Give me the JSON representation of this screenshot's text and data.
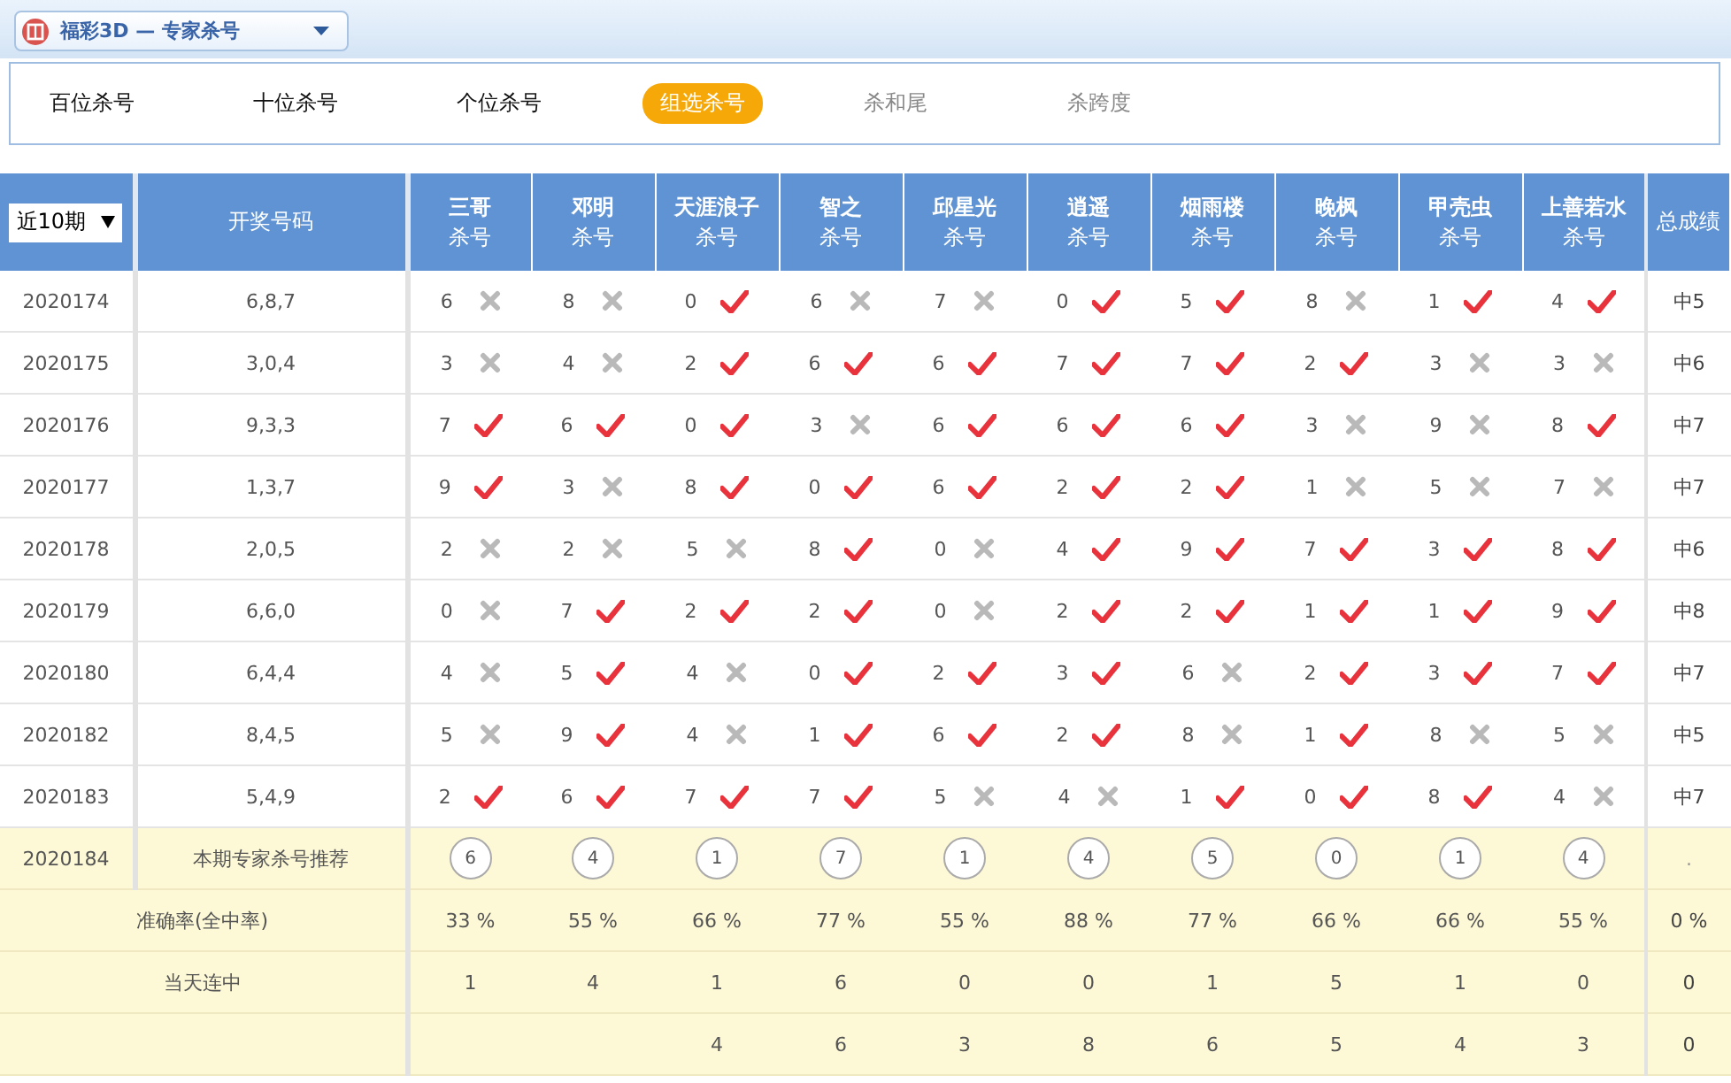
{
  "header": {
    "title": "福彩3D — 专家杀号"
  },
  "tabs": [
    {
      "label": "百位杀号",
      "selected": false,
      "disabled": false
    },
    {
      "label": "十位杀号",
      "selected": false,
      "disabled": false
    },
    {
      "label": "个位杀号",
      "selected": false,
      "disabled": false
    },
    {
      "label": "组选杀号",
      "selected": true,
      "disabled": false
    },
    {
      "label": "杀和尾",
      "selected": false,
      "disabled": true
    },
    {
      "label": "杀跨度",
      "selected": false,
      "disabled": true
    }
  ],
  "period_select": {
    "value": "近10期"
  },
  "columns": {
    "draw": "开奖号码",
    "total": "总成绩",
    "experts": [
      {
        "name": "三哥",
        "sub": "杀号"
      },
      {
        "name": "邓明",
        "sub": "杀号"
      },
      {
        "name": "天涯浪子",
        "sub": "杀号"
      },
      {
        "name": "智之",
        "sub": "杀号"
      },
      {
        "name": "邱星光",
        "sub": "杀号"
      },
      {
        "name": "逍遥",
        "sub": "杀号"
      },
      {
        "name": "烟雨楼",
        "sub": "杀号"
      },
      {
        "name": "晚枫",
        "sub": "杀号"
      },
      {
        "name": "甲壳虫",
        "sub": "杀号"
      },
      {
        "name": "上善若水",
        "sub": "杀号"
      }
    ]
  },
  "rows": [
    {
      "period": "2020174",
      "draw": "6,8,7",
      "total": "中5",
      "cells": [
        {
          "n": "6",
          "hit": false
        },
        {
          "n": "8",
          "hit": false
        },
        {
          "n": "0",
          "hit": true
        },
        {
          "n": "6",
          "hit": false
        },
        {
          "n": "7",
          "hit": false
        },
        {
          "n": "0",
          "hit": true
        },
        {
          "n": "5",
          "hit": true
        },
        {
          "n": "8",
          "hit": false
        },
        {
          "n": "1",
          "hit": true
        },
        {
          "n": "4",
          "hit": true
        }
      ]
    },
    {
      "period": "2020175",
      "draw": "3,0,4",
      "total": "中6",
      "cells": [
        {
          "n": "3",
          "hit": false
        },
        {
          "n": "4",
          "hit": false
        },
        {
          "n": "2",
          "hit": true
        },
        {
          "n": "6",
          "hit": true
        },
        {
          "n": "6",
          "hit": true
        },
        {
          "n": "7",
          "hit": true
        },
        {
          "n": "7",
          "hit": true
        },
        {
          "n": "2",
          "hit": true
        },
        {
          "n": "3",
          "hit": false
        },
        {
          "n": "3",
          "hit": false
        }
      ]
    },
    {
      "period": "2020176",
      "draw": "9,3,3",
      "total": "中7",
      "cells": [
        {
          "n": "7",
          "hit": true
        },
        {
          "n": "6",
          "hit": true
        },
        {
          "n": "0",
          "hit": true
        },
        {
          "n": "3",
          "hit": false
        },
        {
          "n": "6",
          "hit": true
        },
        {
          "n": "6",
          "hit": true
        },
        {
          "n": "6",
          "hit": true
        },
        {
          "n": "3",
          "hit": false
        },
        {
          "n": "9",
          "hit": false
        },
        {
          "n": "8",
          "hit": true
        }
      ]
    },
    {
      "period": "2020177",
      "draw": "1,3,7",
      "total": "中7",
      "cells": [
        {
          "n": "9",
          "hit": true
        },
        {
          "n": "3",
          "hit": false
        },
        {
          "n": "8",
          "hit": true
        },
        {
          "n": "0",
          "hit": true
        },
        {
          "n": "6",
          "hit": true
        },
        {
          "n": "2",
          "hit": true
        },
        {
          "n": "2",
          "hit": true
        },
        {
          "n": "1",
          "hit": false
        },
        {
          "n": "5",
          "hit": false
        },
        {
          "n": "7",
          "hit": false
        }
      ]
    },
    {
      "period": "2020178",
      "draw": "2,0,5",
      "total": "中6",
      "cells": [
        {
          "n": "2",
          "hit": false
        },
        {
          "n": "2",
          "hit": false
        },
        {
          "n": "5",
          "hit": false
        },
        {
          "n": "8",
          "hit": true
        },
        {
          "n": "0",
          "hit": false
        },
        {
          "n": "4",
          "hit": true
        },
        {
          "n": "9",
          "hit": true
        },
        {
          "n": "7",
          "hit": true
        },
        {
          "n": "3",
          "hit": true
        },
        {
          "n": "8",
          "hit": true
        }
      ]
    },
    {
      "period": "2020179",
      "draw": "6,6,0",
      "total": "中8",
      "cells": [
        {
          "n": "0",
          "hit": false
        },
        {
          "n": "7",
          "hit": true
        },
        {
          "n": "2",
          "hit": true
        },
        {
          "n": "2",
          "hit": true
        },
        {
          "n": "0",
          "hit": false
        },
        {
          "n": "2",
          "hit": true
        },
        {
          "n": "2",
          "hit": true
        },
        {
          "n": "1",
          "hit": true
        },
        {
          "n": "1",
          "hit": true
        },
        {
          "n": "9",
          "hit": true
        }
      ]
    },
    {
      "period": "2020180",
      "draw": "6,4,4",
      "total": "中7",
      "cells": [
        {
          "n": "4",
          "hit": false
        },
        {
          "n": "5",
          "hit": true
        },
        {
          "n": "4",
          "hit": false
        },
        {
          "n": "0",
          "hit": true
        },
        {
          "n": "2",
          "hit": true
        },
        {
          "n": "3",
          "hit": true
        },
        {
          "n": "6",
          "hit": false
        },
        {
          "n": "2",
          "hit": true
        },
        {
          "n": "3",
          "hit": true
        },
        {
          "n": "7",
          "hit": true
        }
      ]
    },
    {
      "period": "2020182",
      "draw": "8,4,5",
      "total": "中5",
      "cells": [
        {
          "n": "5",
          "hit": false
        },
        {
          "n": "9",
          "hit": true
        },
        {
          "n": "4",
          "hit": false
        },
        {
          "n": "1",
          "hit": true
        },
        {
          "n": "6",
          "hit": true
        },
        {
          "n": "2",
          "hit": true
        },
        {
          "n": "8",
          "hit": false
        },
        {
          "n": "1",
          "hit": true
        },
        {
          "n": "8",
          "hit": false
        },
        {
          "n": "5",
          "hit": false
        }
      ]
    },
    {
      "period": "2020183",
      "draw": "5,4,9",
      "total": "中7",
      "cells": [
        {
          "n": "2",
          "hit": true
        },
        {
          "n": "6",
          "hit": true
        },
        {
          "n": "7",
          "hit": true
        },
        {
          "n": "7",
          "hit": true
        },
        {
          "n": "5",
          "hit": false
        },
        {
          "n": "4",
          "hit": false
        },
        {
          "n": "1",
          "hit": true
        },
        {
          "n": "0",
          "hit": true
        },
        {
          "n": "8",
          "hit": true
        },
        {
          "n": "4",
          "hit": false
        }
      ]
    }
  ],
  "recommend": {
    "period": "2020184",
    "label": "本期专家杀号推荐",
    "picks": [
      "6",
      "4",
      "1",
      "7",
      "1",
      "4",
      "5",
      "0",
      "1",
      "4"
    ],
    "total": "."
  },
  "accuracy": {
    "label": "准确率(全中率)",
    "values": [
      "33 %",
      "55 %",
      "66 %",
      "77 %",
      "55 %",
      "88 %",
      "77 %",
      "66 %",
      "66 %",
      "55 %"
    ],
    "total": "0 %"
  },
  "streak": {
    "label": "当天连中",
    "values": [
      "1",
      "4",
      "1",
      "6",
      "0",
      "0",
      "1",
      "5",
      "1",
      "0"
    ],
    "total": "0"
  },
  "last_row": {
    "values_from_expert_3": [
      "4",
      "6",
      "3",
      "8",
      "6",
      "5",
      "4",
      "3"
    ],
    "total": "0"
  }
}
